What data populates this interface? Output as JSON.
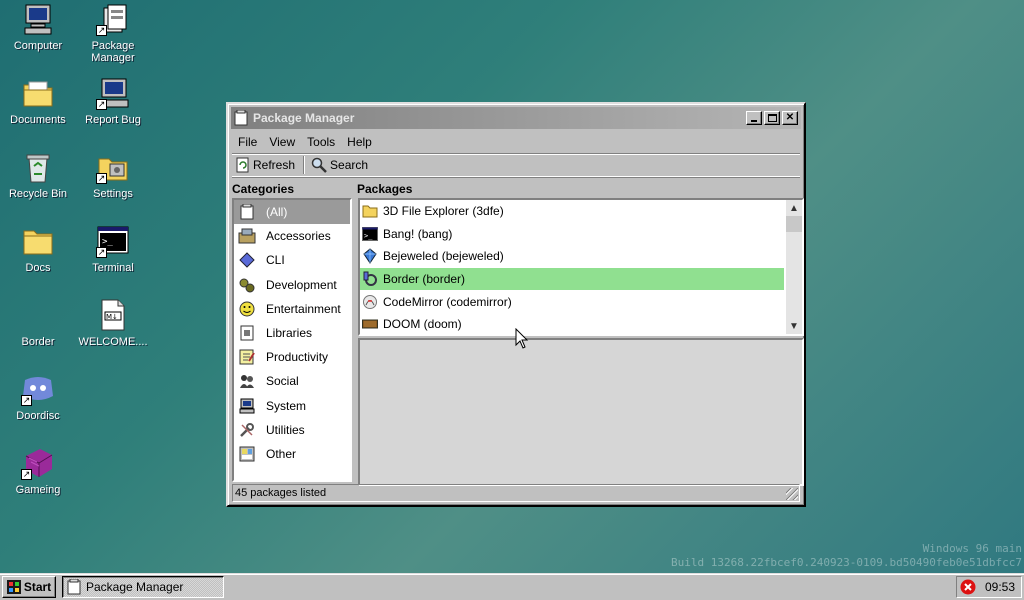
{
  "desktop": {
    "icons": [
      {
        "label": "Computer",
        "icon": "computer-icon"
      },
      {
        "label": "Package Manager",
        "icon": "package-manager-icon"
      },
      {
        "label": "Documents",
        "icon": "documents-folder-icon"
      },
      {
        "label": "Report Bug",
        "icon": "report-bug-icon"
      },
      {
        "label": "Recycle Bin",
        "icon": "recycle-bin-icon"
      },
      {
        "label": "Settings",
        "icon": "settings-folder-icon"
      },
      {
        "label": "Docs",
        "icon": "docs-folder-icon"
      },
      {
        "label": "Terminal",
        "icon": "terminal-icon"
      },
      {
        "label": "Border",
        "icon": "border-icon"
      },
      {
        "label": "WELCOME....",
        "icon": "markdown-file-icon"
      },
      {
        "label": "Doordisc",
        "icon": "doordisc-icon"
      },
      {
        "label": "Gameing",
        "icon": "gameing-icon"
      }
    ]
  },
  "window": {
    "title": "Package Manager",
    "menu": [
      "File",
      "View",
      "Tools",
      "Help"
    ],
    "toolbar": {
      "refresh": "Refresh",
      "search": "Search"
    },
    "categories_header": "Categories",
    "packages_header": "Packages",
    "categories": [
      {
        "label": "(All)",
        "icon": "all-icon",
        "selected": true
      },
      {
        "label": "Accessories",
        "icon": "accessories-icon"
      },
      {
        "label": "CLI",
        "icon": "cli-icon"
      },
      {
        "label": "Development",
        "icon": "development-icon"
      },
      {
        "label": "Entertainment",
        "icon": "entertainment-icon"
      },
      {
        "label": "Libraries",
        "icon": "libraries-icon"
      },
      {
        "label": "Productivity",
        "icon": "productivity-icon"
      },
      {
        "label": "Social",
        "icon": "social-icon"
      },
      {
        "label": "System",
        "icon": "system-icon"
      },
      {
        "label": "Utilities",
        "icon": "utilities-icon"
      },
      {
        "label": "Other",
        "icon": "other-icon"
      }
    ],
    "packages": [
      {
        "label": "3D File Explorer (3dfe)",
        "icon": "folder-icon"
      },
      {
        "label": "Bang! (bang)",
        "icon": "terminal-icon"
      },
      {
        "label": "Bejeweled (bejeweled)",
        "icon": "gem-icon"
      },
      {
        "label": "Border (border)",
        "icon": "border-icon",
        "selected": true
      },
      {
        "label": "CodeMirror (codemirror)",
        "icon": "codemirror-icon"
      },
      {
        "label": "DOOM (doom)",
        "icon": "doom-icon"
      }
    ],
    "status": "45 packages listed"
  },
  "watermark": {
    "line1": "Windows 96 main",
    "line2": "Build 13268.22fbcef0.240923-0109.bd50490feb0e51dbfcc7"
  },
  "taskbar": {
    "start": "Start",
    "task": "Package Manager",
    "clock": "09:53"
  },
  "colors": {
    "selection_package": "#90e090",
    "selection_category": "#9a9a9a",
    "window_face": "#c0c0c0"
  }
}
